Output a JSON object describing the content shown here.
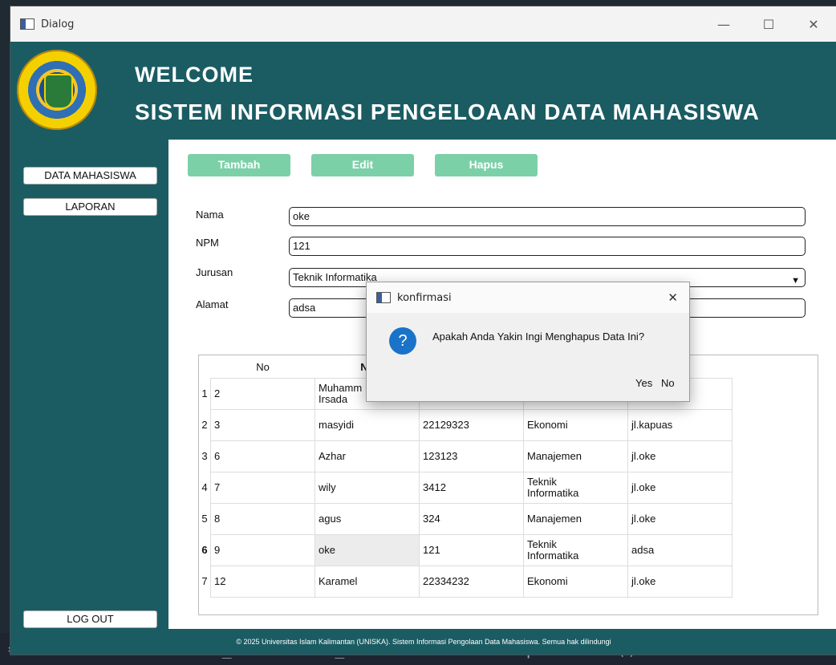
{
  "background_code": "= self.ui.mahasiswa_dashboard_window.lineNomInput.text()",
  "window": {
    "title": "Dialog",
    "minimize": "—",
    "maximize": "☐",
    "close": "✕"
  },
  "header": {
    "welcome": "WELCOME",
    "subtitle": "SISTEM INFORMASI PENGELOAAN DATA MAHASISWA"
  },
  "sidebar": {
    "data_mahasiswa": "DATA MAHASISWA",
    "laporan": "LAPORAN",
    "logout": "LOG OUT"
  },
  "actions": {
    "tambah": "Tambah",
    "edit": "Edit",
    "hapus": "Hapus"
  },
  "form": {
    "nama_label": "Nama",
    "nama_value": "oke",
    "npm_label": "NPM",
    "npm_value": "121",
    "jurusan_label": "Jurusan",
    "jurusan_value": "Teknik Informatika",
    "alamat_label": "Alamat",
    "alamat_value": "adsa"
  },
  "table": {
    "headers": [
      "No",
      "Na",
      "",
      "",
      "at"
    ],
    "rows": [
      {
        "index": "1",
        "no": "2",
        "nama": "Muhamm\nIrsada",
        "npm": "",
        "jurusan": "",
        "alamat": "hijau"
      },
      {
        "index": "2",
        "no": "3",
        "nama": "masyidi",
        "npm": "22129323",
        "jurusan": "Ekonomi",
        "alamat": "jl.kapuas"
      },
      {
        "index": "3",
        "no": "6",
        "nama": "Azhar",
        "npm": "123123",
        "jurusan": "Manajemen",
        "alamat": "jl.oke"
      },
      {
        "index": "4",
        "no": "7",
        "nama": "wily",
        "npm": "3412",
        "jurusan": "Teknik\nInformatika",
        "alamat": "jl.oke"
      },
      {
        "index": "5",
        "no": "8",
        "nama": "agus",
        "npm": "324",
        "jurusan": "Manajemen",
        "alamat": "jl.oke"
      },
      {
        "index": "6",
        "no": "9",
        "nama": "oke",
        "npm": "121",
        "jurusan": "Teknik\nInformatika",
        "alamat": "adsa"
      },
      {
        "index": "7",
        "no": "12",
        "nama": "Karamel",
        "npm": "22334232",
        "jurusan": "Ekonomi",
        "alamat": "jl.oke"
      }
    ]
  },
  "footer": "© 2025 Universitas Islam Kalimantan (UNISKA). Sistem Informasi Pengolaan Data Mahasiswa. Semua hak dilindungi",
  "modal": {
    "title": "konfirmasi",
    "close": "✕",
    "message": "Apakah Anda Yakin Ingi Menghapus Data Ini?",
    "yes": "Yes",
    "no": "No"
  },
  "colors": {
    "primary": "#1b5c63",
    "accent": "#7cd0a8",
    "question_icon": "#1a73c9"
  },
  "icons": {
    "window_icon": "window-icon",
    "dropdown": "chevron-down-icon",
    "question": "question-icon",
    "logo": "uniska-logo"
  }
}
